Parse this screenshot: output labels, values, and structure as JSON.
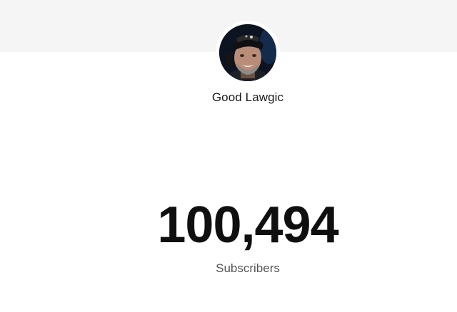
{
  "channel": {
    "name": "Good Lawgic",
    "avatar_icon": "channel-avatar-photo"
  },
  "stats": {
    "subscriber_count": "100,494",
    "subscriber_label": "Subscribers"
  },
  "colors": {
    "banner": "#f5f5f5",
    "background": "#ffffff",
    "count_text": "#0f0f0f",
    "label_text": "#555555"
  }
}
